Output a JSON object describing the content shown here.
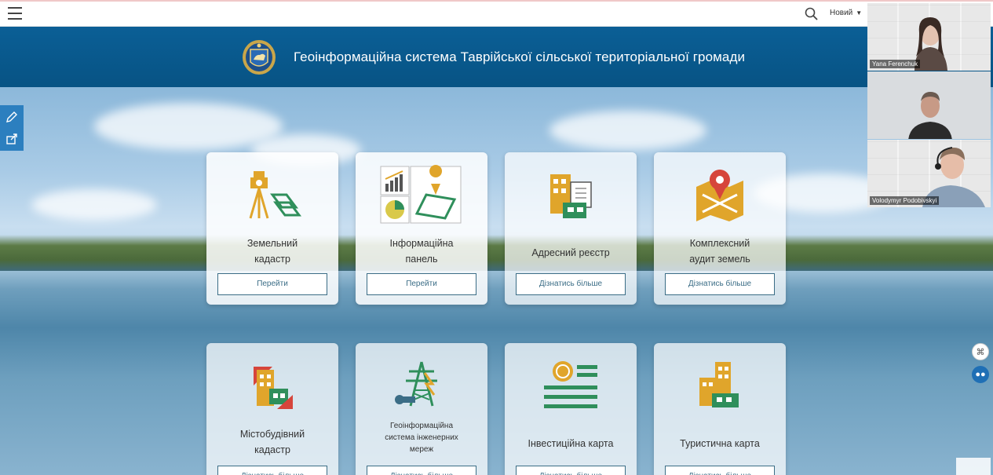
{
  "header": {
    "title": "Геоінформаційна система Таврійської сільської територіальної громади",
    "new_label": "Новий"
  },
  "cards": [
    {
      "title": "Земельний кадастр",
      "line1": "Земельний",
      "line2": "кадастр",
      "button": "Перейти"
    },
    {
      "title": "Інформаційна панель",
      "line1": "Інформаційна",
      "line2": "панель",
      "button": "Перейти"
    },
    {
      "title": "Адресний реєстр",
      "line1": "Адресний реєстр",
      "line2": "",
      "button": "Дізнатись більше"
    },
    {
      "title": "Комплексний аудит земель",
      "line1": "Комплексний",
      "line2": "аудит земель",
      "button": "Дізнатись більше"
    },
    {
      "title": "Містобудівний кадастр",
      "line1": "Містобудівний",
      "line2": "кадастр",
      "button": "Дізнатись більше"
    },
    {
      "title": "Геоінформаційна система інженерних мереж",
      "line1": "Геоінформаційна",
      "line2": "система інженерних",
      "line3": "мереж",
      "button": "Дізнатись більше"
    },
    {
      "title": "Інвестиційна карта",
      "line1": "Інвестиційна карта",
      "line2": "",
      "button": "Дізнатись більше"
    },
    {
      "title": "Туристична карта",
      "line1": "Туристична карта",
      "line2": "",
      "button": "Дізнатись більше"
    }
  ],
  "participants": [
    {
      "name": "Yana Ferenchuk"
    },
    {
      "name": ""
    },
    {
      "name": "Volodymyr Podobivskyi"
    }
  ],
  "colors": {
    "banner": "#0b5f96",
    "accent_gold": "#e0a52b",
    "accent_green": "#2f8f5b",
    "accent_red": "#d6453b",
    "button_border": "#3b6d86"
  }
}
